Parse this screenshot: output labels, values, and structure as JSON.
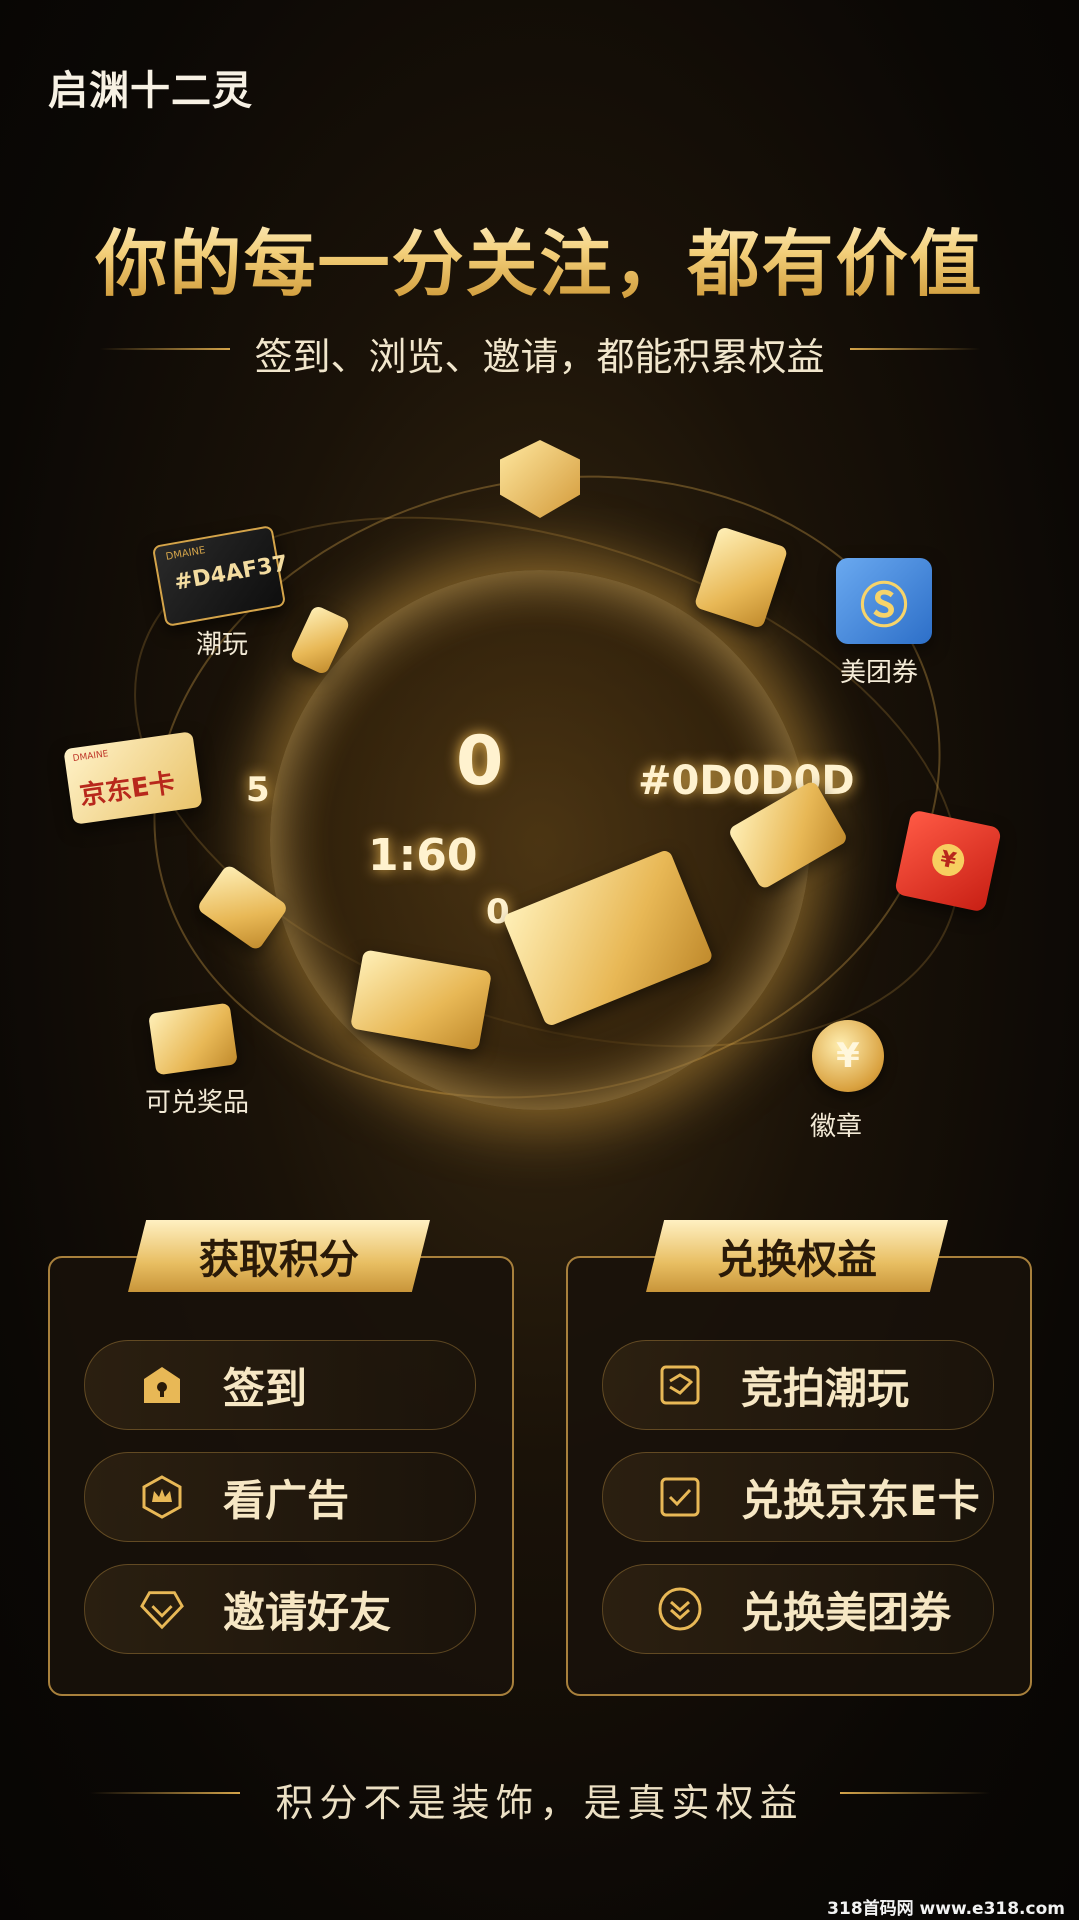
{
  "brand": "启渊十二灵",
  "headline": "你的每一分关注，都有价值",
  "subline": "签到、浏览、邀请，都能积累权益",
  "orb": {
    "big_zero": "0",
    "code_right": "#0D0D0D",
    "time": "1:60",
    "small_zero": "0",
    "five": "5"
  },
  "floating": {
    "card_code": "#D4AF37",
    "card_small": "DMAINE",
    "jd_card_small": "DMAINE",
    "jd_card_text": "京东E卡",
    "labels": {
      "chaowan": "潮玩",
      "meituan": "美团券",
      "prizes": "可兑奖品",
      "badge": "徽章"
    }
  },
  "earn_panel": {
    "title": "获取积分",
    "items": [
      {
        "label": "签到",
        "icon": "check-in-icon"
      },
      {
        "label": "看广告",
        "icon": "ad-crown-icon"
      },
      {
        "label": "邀请好友",
        "icon": "invite-heart-icon"
      }
    ]
  },
  "redeem_panel": {
    "title": "兑换权益",
    "items": [
      {
        "label": "竞拍潮玩",
        "icon": "auction-icon"
      },
      {
        "label": "兑换京东E卡",
        "icon": "jd-card-icon"
      },
      {
        "label": "兑换美团券",
        "icon": "coupon-icon"
      }
    ]
  },
  "footer": "积分不是装饰，是真实权益",
  "watermark": "318首码网 www.e318.com",
  "colors": {
    "gold": "#d4a44a",
    "dark": "#0b0805",
    "red": "#e23a2a",
    "blue": "#3b7fd6"
  }
}
